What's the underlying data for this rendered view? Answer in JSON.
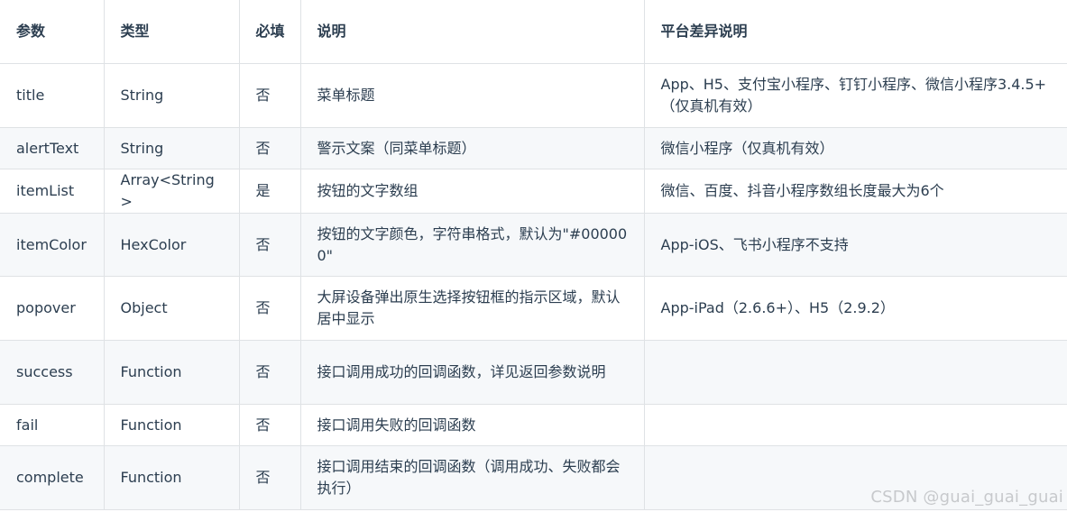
{
  "table": {
    "headers": [
      "参数",
      "类型",
      "必填",
      "说明",
      "平台差异说明"
    ],
    "rows": [
      [
        "title",
        "String",
        "否",
        "菜单标题",
        "App、H5、支付宝小程序、钉钉小程序、微信小程序3.4.5+（仅真机有效）"
      ],
      [
        "alertText",
        "String",
        "否",
        "警示文案（同菜单标题）",
        "微信小程序（仅真机有效）"
      ],
      [
        "itemList",
        "Array<String>",
        "是",
        "按钮的文字数组",
        "微信、百度、抖音小程序数组长度最大为6个"
      ],
      [
        "itemColor",
        "HexColor",
        "否",
        "按钮的文字颜色，字符串格式，默认为\"#000000\"",
        "App-iOS、飞书小程序不支持"
      ],
      [
        "popover",
        "Object",
        "否",
        "大屏设备弹出原生选择按钮框的指示区域，默认居中显示",
        "App-iPad（2.6.6+）、H5（2.9.2）"
      ],
      [
        "success",
        "Function",
        "否",
        "接口调用成功的回调函数，详见返回参数说明",
        ""
      ],
      [
        "fail",
        "Function",
        "否",
        "接口调用失败的回调函数",
        ""
      ],
      [
        "complete",
        "Function",
        "否",
        "接口调用结束的回调函数（调用成功、失败都会执行）",
        ""
      ]
    ]
  },
  "watermark": "CSDN @guai_guai_guai"
}
